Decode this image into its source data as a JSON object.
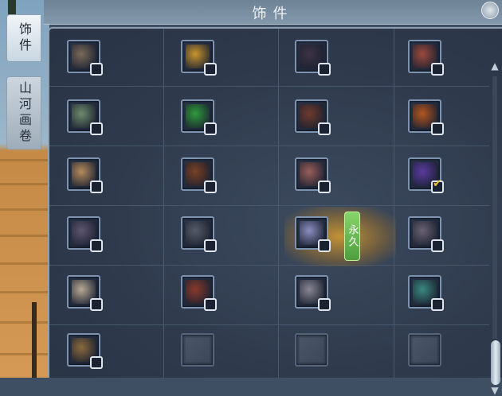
{
  "header": {
    "title": "饰件"
  },
  "side_tabs": [
    {
      "label": "饰件",
      "active": true
    },
    {
      "label": "山河画卷",
      "active": false
    }
  ],
  "selected_badge": "永久",
  "rows": [
    [
      {
        "icon": "spearhead-accessory-icon",
        "color": "#7a6a58",
        "checked": false
      },
      {
        "icon": "golden-orb-accessory-icon",
        "color": "#c8952e",
        "checked": false
      },
      {
        "icon": "dark-fan-accessory-icon",
        "color": "#3c3346",
        "checked": false
      },
      {
        "icon": "red-pouch-accessory-icon",
        "color": "#9c4a3e",
        "checked": false
      }
    ],
    [
      {
        "icon": "jade-wreath-accessory-icon",
        "color": "#6f8a6e",
        "checked": false
      },
      {
        "icon": "green-ring-accessory-icon",
        "color": "#2f9a3b",
        "checked": false
      },
      {
        "icon": "bronze-disc-accessory-icon",
        "color": "#6e3a2c",
        "checked": false
      },
      {
        "icon": "amber-lantern-accessory-icon",
        "color": "#b3561f",
        "checked": false
      }
    ],
    [
      {
        "icon": "fox-figurine-accessory-icon",
        "color": "#b58b5c",
        "checked": false
      },
      {
        "icon": "fire-spirit-accessory-icon",
        "color": "#7a4024",
        "checked": false
      },
      {
        "icon": "coral-cluster-accessory-icon",
        "color": "#9a5e5a",
        "checked": false
      },
      {
        "icon": "purple-mask-accessory-icon",
        "color": "#5b3ba0",
        "checked": true
      }
    ],
    [
      {
        "icon": "flower-branch-accessory-icon",
        "color": "#5e5670",
        "checked": false
      },
      {
        "icon": "slender-flute-accessory-icon",
        "color": "#585c68",
        "checked": false
      },
      {
        "icon": "white-cat-accessory-icon",
        "color": "#8c8fc0",
        "checked": false
      },
      {
        "icon": "moon-lute-accessory-icon",
        "color": "#6a6170",
        "checked": false
      }
    ],
    [
      {
        "icon": "silver-medallion-accessory-icon",
        "color": "#b7aa94",
        "checked": false
      },
      {
        "icon": "red-lantern-accessory-icon",
        "color": "#8a3a2a",
        "checked": false
      },
      {
        "icon": "dragonfly-accessory-icon",
        "color": "#8a8793",
        "checked": false
      },
      {
        "icon": "red-jade-accessory-icon",
        "color": "#3a8880",
        "checked": false
      }
    ],
    [
      {
        "icon": "firework-accessory-icon",
        "color": "#8a6a3c",
        "checked": false
      },
      {
        "icon": "empty-slot-icon",
        "color": "",
        "checked": null
      },
      {
        "icon": "empty-slot-icon",
        "color": "",
        "checked": null
      },
      {
        "icon": "empty-slot-icon",
        "color": "",
        "checked": null
      }
    ]
  ]
}
